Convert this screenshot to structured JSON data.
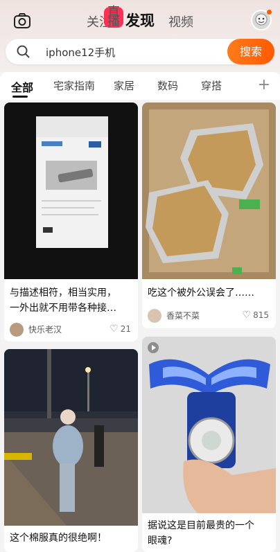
{
  "header": {
    "tabs": [
      "关注",
      "发现",
      "视频"
    ],
    "live_badge": "直播",
    "active_tab": "发现"
  },
  "search": {
    "query": "iphone12手机",
    "button_label": "搜索"
  },
  "categories": [
    "全部",
    "宅家指南",
    "家居",
    "数码",
    "穿搭"
  ],
  "feed": [
    {
      "title_line1": "与描述相符，相当实用，",
      "title_line2": "一外出就不用带各种接…",
      "author": "快乐老汉",
      "likes": "21"
    },
    {
      "title_line1": "吃这个被外公误会了……",
      "title_line2": "",
      "author": "香菜不菜",
      "likes": "815"
    },
    {
      "title_line1": "这个棉服真的很绝啊！",
      "title_line2": "",
      "author": "",
      "likes": ""
    },
    {
      "title_line1": "据说这是目前最贵的一个",
      "title_line2": "眼魂?",
      "author": "",
      "likes": ""
    }
  ],
  "colors": {
    "accent": "#ff5a00",
    "live": "#ff2f55"
  }
}
